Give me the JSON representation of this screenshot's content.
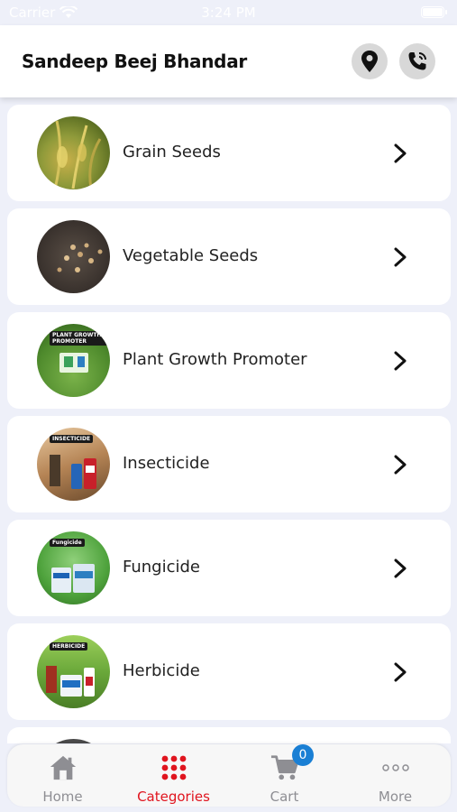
{
  "status_bar": {
    "carrier": "Carrier",
    "time": "3:24 PM"
  },
  "header": {
    "title": "Sandeep Beej Bhandar"
  },
  "categories": [
    {
      "label": "Grain Seeds"
    },
    {
      "label": "Vegetable Seeds"
    },
    {
      "label": "Plant Growth Promoter",
      "badge": "PLANT GROWTH PROMOTER"
    },
    {
      "label": "Insecticide",
      "badge": "INSECTICIDE"
    },
    {
      "label": "Fungicide",
      "badge": "Fungicide"
    },
    {
      "label": "Herbicide",
      "badge": "HERBICIDE"
    }
  ],
  "tabbar": {
    "home": "Home",
    "categories": "Categories",
    "cart": "Cart",
    "cart_count": "0",
    "more": "More"
  },
  "colors": {
    "accent": "#e0141e",
    "badge": "#1a7fd4",
    "background": "#eef0f9"
  }
}
